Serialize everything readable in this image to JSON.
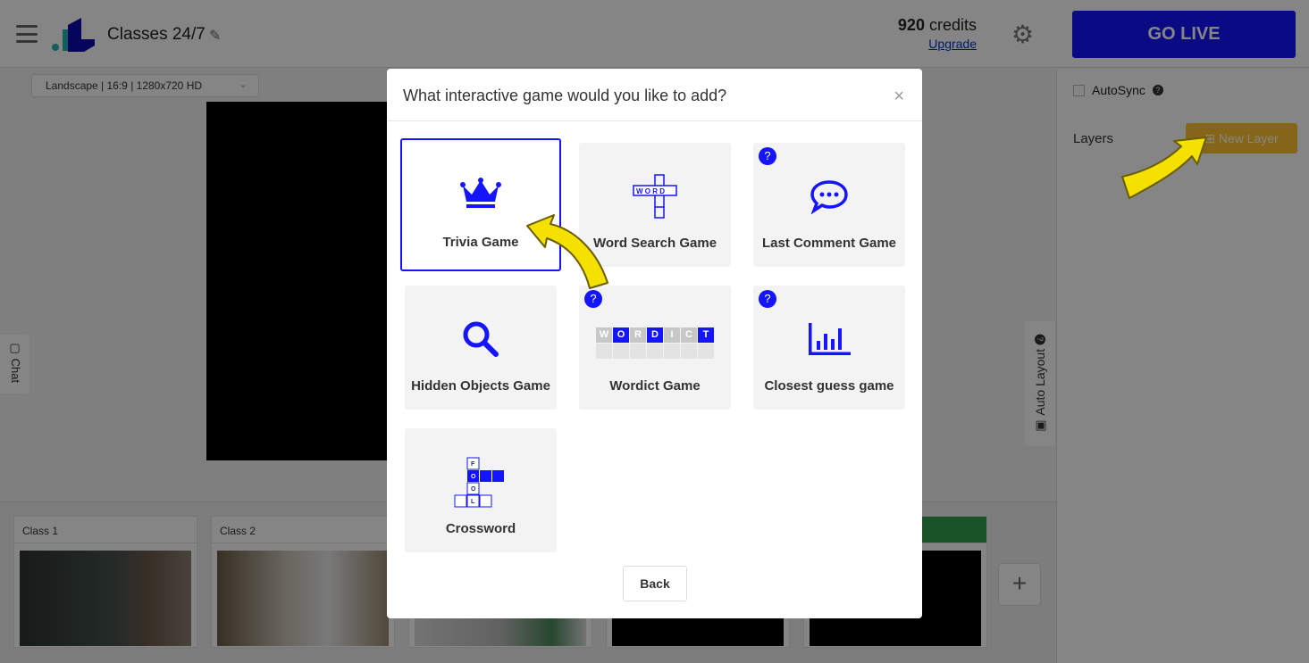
{
  "header": {
    "title": "Classes 24/7",
    "credits_value": "920",
    "credits_label": "credits",
    "upgrade": "Upgrade",
    "go_live": "GO LIVE"
  },
  "right_panel": {
    "autosync": "AutoSync",
    "layers": "Layers",
    "new_layer": "New Layer"
  },
  "canvas": {
    "resolution": "Landscape | 16:9 | 1280x720 HD"
  },
  "side_tabs": {
    "chat": "Chat",
    "auto_layout": "Auto Layout"
  },
  "scenes": [
    {
      "label": "Class 1"
    },
    {
      "label": "Class 2"
    },
    {
      "label": ""
    },
    {
      "label": ""
    },
    {
      "label": "",
      "active": true
    }
  ],
  "modal": {
    "title": "What interactive game would you like to add?",
    "games": [
      {
        "name": "Trivia Game",
        "icon": "crown-icon",
        "selected": true
      },
      {
        "name": "Word Search Game",
        "icon": "word-cross-icon"
      },
      {
        "name": "Last Comment Game",
        "icon": "speech-bubble-icon",
        "help": true
      },
      {
        "name": "Hidden Objects Game",
        "icon": "magnifier-icon"
      },
      {
        "name": "Wordict Game",
        "icon": "wordict-grid-icon",
        "help": true,
        "letters": [
          "W",
          "O",
          "R",
          "D",
          "I",
          "C",
          "T"
        ]
      },
      {
        "name": "Closest guess game",
        "icon": "bar-chart-icon",
        "help": true
      },
      {
        "name": "Crossword",
        "icon": "crossword-icon",
        "letters": [
          "F",
          "O",
          "O",
          "L"
        ]
      }
    ],
    "back": "Back"
  },
  "colors": {
    "accent": "#1414ff",
    "go_live": "#1414ff",
    "new_layer": "#ffc42e",
    "active_scene": "#2ea04e",
    "annotation_arrow": "#f5e100"
  }
}
